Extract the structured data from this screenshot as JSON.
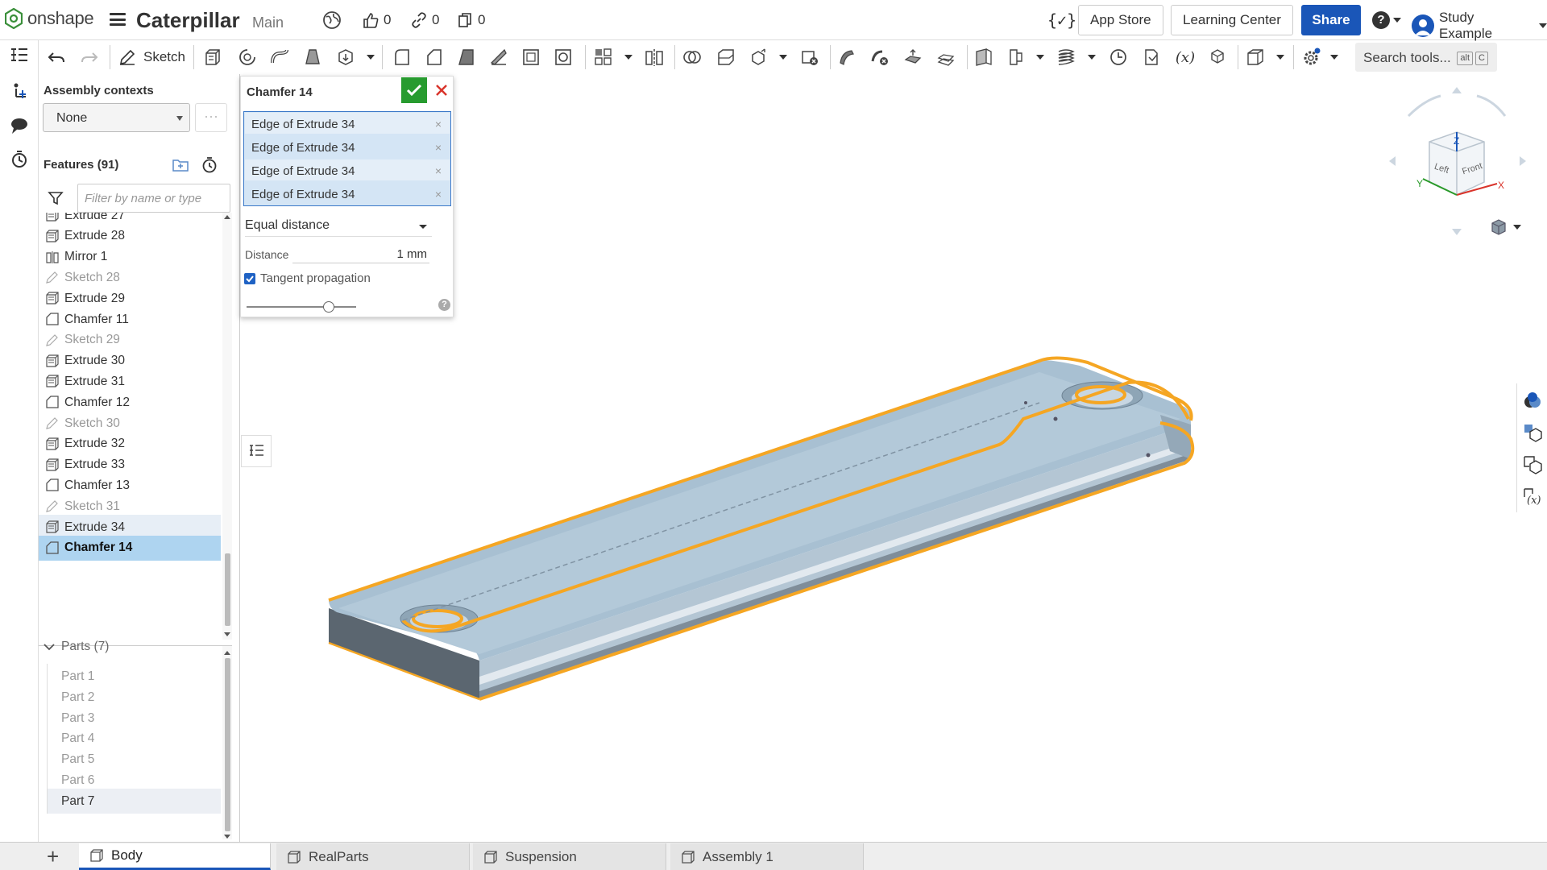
{
  "header": {
    "logo_text": "onshape",
    "doc_title": "Caterpillar",
    "branch": "Main",
    "likes": "0",
    "links": "0",
    "copies": "0",
    "fs_label": "{✓}",
    "app_store": "App Store",
    "learning_center": "Learning Center",
    "share": "Share",
    "help": "?",
    "user_name": "Study Example"
  },
  "toolbar": {
    "sketch_label": "Sketch",
    "search_placeholder": "Search tools...",
    "search_key1": "alt",
    "search_key2": "C",
    "variable_label": "(x)"
  },
  "panel": {
    "contexts_label": "Assembly contexts",
    "context_value": "None",
    "more_label": "···",
    "features_label": "Features (91)",
    "filter_placeholder": "Filter by name or type",
    "features": [
      {
        "label": "Extrude 27",
        "kind": "extrude"
      },
      {
        "label": "Extrude 28",
        "kind": "extrude"
      },
      {
        "label": "Mirror 1",
        "kind": "mirror"
      },
      {
        "label": "Sketch 28",
        "kind": "sketch"
      },
      {
        "label": "Extrude 29",
        "kind": "extrude"
      },
      {
        "label": "Chamfer 11",
        "kind": "chamfer"
      },
      {
        "label": "Sketch 29",
        "kind": "sketch"
      },
      {
        "label": "Extrude 30",
        "kind": "extrude"
      },
      {
        "label": "Extrude 31",
        "kind": "extrude"
      },
      {
        "label": "Chamfer 12",
        "kind": "chamfer"
      },
      {
        "label": "Sketch 30",
        "kind": "sketch"
      },
      {
        "label": "Extrude 32",
        "kind": "extrude"
      },
      {
        "label": "Extrude 33",
        "kind": "extrude"
      },
      {
        "label": "Chamfer 13",
        "kind": "chamfer"
      },
      {
        "label": "Sketch 31",
        "kind": "sketch"
      },
      {
        "label": "Extrude 34",
        "kind": "extrude",
        "state": "hover"
      },
      {
        "label": "Chamfer 14",
        "kind": "chamfer",
        "state": "selected"
      }
    ],
    "parts_label": "Parts (7)",
    "parts": [
      "Part 1",
      "Part 2",
      "Part 3",
      "Part 4",
      "Part 5",
      "Part 6",
      "Part 7"
    ]
  },
  "dialog": {
    "title": "Chamfer 14",
    "selections": [
      "Edge of Extrude 34",
      "Edge of Extrude 34",
      "Edge of Extrude 34",
      "Edge of Extrude 34"
    ],
    "remove_glyph": "×",
    "type_value": "Equal distance",
    "distance_label": "Distance",
    "distance_value": "1 mm",
    "tangent_label": "Tangent propagation",
    "tangent_checked": true,
    "help": "?"
  },
  "navcube": {
    "top_label": "Z",
    "left_label": "Left",
    "front_label": "Front",
    "x_label": "X",
    "y_label": "Y"
  },
  "tabs": [
    {
      "label": "Body",
      "active": true
    },
    {
      "label": "RealParts",
      "active": false
    },
    {
      "label": "Suspension",
      "active": false
    },
    {
      "label": "Assembly 1",
      "active": false
    }
  ],
  "colors": {
    "accent": "#1a56b8",
    "confirm": "#279b2f",
    "selection_highlight": "#f5a623",
    "part_face": "#a9c1d3",
    "selected_feature_bg": "#aed4f0"
  }
}
